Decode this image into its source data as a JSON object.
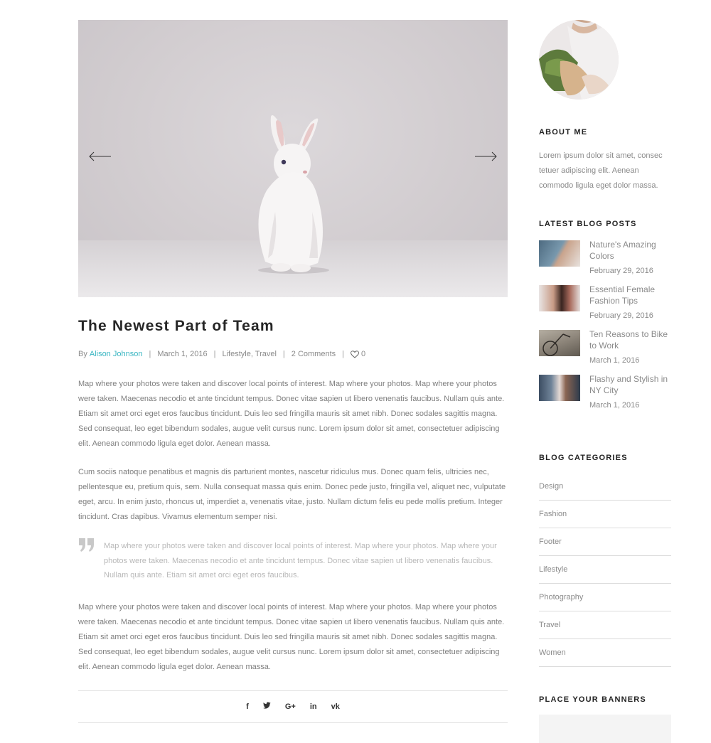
{
  "post": {
    "title": "The Newest Part of Team",
    "meta": {
      "by": "By",
      "author": "Alison Johnson",
      "date": "March 1, 2016",
      "categories": "Lifestyle, Travel",
      "comments": "2 Comments",
      "likes": "0"
    },
    "paragraph1": "Map where your photos were taken and discover local points of interest. Map where your photos. Map where your photos were taken. Maecenas necodio et ante tincidunt tempus. Donec vitae sapien ut libero venenatis faucibus. Nullam quis ante. Etiam sit amet orci eget eros faucibus tincidunt. Duis leo sed fringilla mauris sit amet nibh. Donec sodales sagittis magna. Sed consequat, leo eget bibendum sodales, augue velit cursus nunc. Lorem ipsum dolor sit amet, consectetuer adipiscing elit. Aenean commodo ligula eget dolor. Aenean massa.",
    "paragraph2": "Cum sociis natoque penatibus et magnis dis parturient montes, nascetur ridiculus mus. Donec quam felis, ultricies nec, pellentesque eu, pretium quis, sem. Nulla consequat massa quis enim. Donec pede justo, fringilla vel, aliquet nec, vulputate eget, arcu. In enim justo, rhoncus ut, imperdiet a, venenatis vitae, justo. Nullam dictum felis eu pede mollis pretium. Integer tincidunt. Cras dapibus. Vivamus elementum semper nisi.",
    "quote": "Map where your photos were taken and discover local points of interest. Map where your photos. Map where your photos were taken. Maecenas necodio et ante tincidunt tempus. Donec vitae sapien ut libero venenatis faucibus. Nullam quis ante. Etiam sit amet orci eget eros faucibus.",
    "paragraph3": "Map where your photos were taken and discover local points of interest. Map where your photos. Map where your photos were taken. Maecenas necodio et ante tincidunt tempus. Donec vitae sapien ut libero venenatis faucibus. Nullam quis ante. Etiam sit amet orci eget eros faucibus tincidunt. Duis leo sed fringilla mauris sit amet nibh. Donec sodales sagittis magna. Sed consequat, leo eget bibendum sodales, augue velit cursus nunc. Lorem ipsum dolor sit amet, consectetuer adipiscing elit. Aenean commodo ligula eget dolor. Aenean massa.",
    "share": {
      "facebook": "f",
      "twitter": "🐦",
      "google": "G+",
      "linkedin": "in",
      "vk": "vk"
    }
  },
  "sidebar": {
    "about": {
      "title": "ABOUT ME",
      "text": "Lorem ipsum dolor sit amet, consec tetuer adipiscing elit. Aenean commodo ligula eget dolor massa."
    },
    "latest": {
      "title": "LATEST BLOG POSTS",
      "items": [
        {
          "title": "Nature's Amazing Colors",
          "date": "February 29, 2016"
        },
        {
          "title": "Essential Female Fashion Tips",
          "date": "February 29, 2016"
        },
        {
          "title": "Ten Reasons to Bike to Work",
          "date": "March 1, 2016"
        },
        {
          "title": "Flashy and Stylish in NY City",
          "date": "March 1, 2016"
        }
      ]
    },
    "categories": {
      "title": "BLOG CATEGORIES",
      "items": [
        "Design",
        "Fashion",
        "Footer",
        "Lifestyle",
        "Photography",
        "Travel",
        "Women"
      ]
    },
    "banners": {
      "title": "PLACE YOUR BANNERS"
    }
  },
  "colors": {
    "accent": "#3ab6c2",
    "heading": "#262626",
    "text": "#7e7e7e",
    "divider": "#dcdcdc"
  },
  "icons": {
    "slider_prev": "arrow-left-icon",
    "slider_next": "arrow-right-icon",
    "likes": "heart-icon",
    "quote": "quote-icon"
  }
}
